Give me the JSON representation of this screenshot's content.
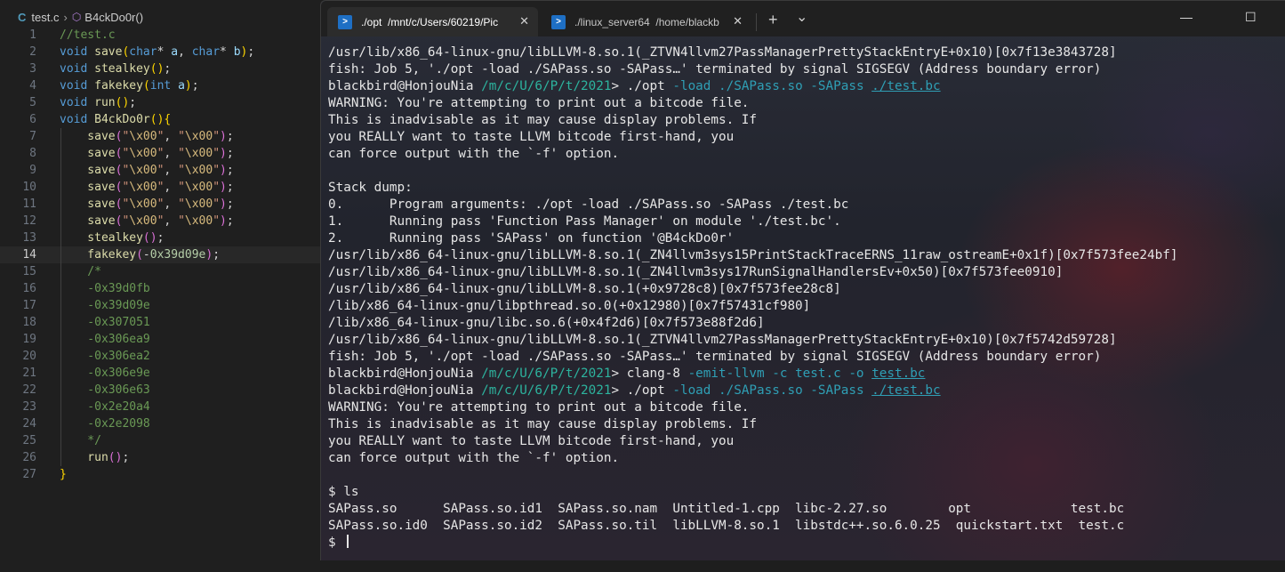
{
  "editor": {
    "breadcrumb": {
      "file_icon": "C",
      "file": "test.c",
      "symbol": "B4ckDo0r()"
    },
    "active_line": 14,
    "lines": [
      {
        "n": "1",
        "tokens": [
          {
            "t": "//test.c",
            "c": "comment"
          }
        ]
      },
      {
        "n": "2",
        "tokens": [
          {
            "t": "void ",
            "c": "kw"
          },
          {
            "t": "save",
            "c": "fn"
          },
          {
            "t": "(",
            "c": "br1"
          },
          {
            "t": "char",
            "c": "kw"
          },
          {
            "t": "* ",
            "c": "plain"
          },
          {
            "t": "a",
            "c": "param"
          },
          {
            "t": ", ",
            "c": "plain"
          },
          {
            "t": "char",
            "c": "kw"
          },
          {
            "t": "* ",
            "c": "plain"
          },
          {
            "t": "b",
            "c": "param"
          },
          {
            "t": ")",
            "c": "br1"
          },
          {
            "t": ";",
            "c": "plain"
          }
        ]
      },
      {
        "n": "3",
        "tokens": [
          {
            "t": "void ",
            "c": "kw"
          },
          {
            "t": "stealkey",
            "c": "fn"
          },
          {
            "t": "()",
            "c": "br1"
          },
          {
            "t": ";",
            "c": "plain"
          }
        ]
      },
      {
        "n": "4",
        "tokens": [
          {
            "t": "void ",
            "c": "kw"
          },
          {
            "t": "fakekey",
            "c": "fn"
          },
          {
            "t": "(",
            "c": "br1"
          },
          {
            "t": "int ",
            "c": "kw"
          },
          {
            "t": "a",
            "c": "param"
          },
          {
            "t": ")",
            "c": "br1"
          },
          {
            "t": ";",
            "c": "plain"
          }
        ]
      },
      {
        "n": "5",
        "tokens": [
          {
            "t": "void ",
            "c": "kw"
          },
          {
            "t": "run",
            "c": "fn"
          },
          {
            "t": "()",
            "c": "br1"
          },
          {
            "t": ";",
            "c": "plain"
          }
        ]
      },
      {
        "n": "6",
        "tokens": [
          {
            "t": "void ",
            "c": "kw"
          },
          {
            "t": "B4ckDo0r",
            "c": "fn"
          },
          {
            "t": "()",
            "c": "br1"
          },
          {
            "t": "{",
            "c": "br1"
          }
        ]
      },
      {
        "n": "7",
        "tokens": [
          {
            "t": "    save",
            "c": "fn"
          },
          {
            "t": "(",
            "c": "br2"
          },
          {
            "t": "\"",
            "c": "str"
          },
          {
            "t": "\\x00",
            "c": "esc"
          },
          {
            "t": "\"",
            "c": "str"
          },
          {
            "t": ", ",
            "c": "plain"
          },
          {
            "t": "\"",
            "c": "str"
          },
          {
            "t": "\\x00",
            "c": "esc"
          },
          {
            "t": "\"",
            "c": "str"
          },
          {
            "t": ")",
            "c": "br2"
          },
          {
            "t": ";",
            "c": "plain"
          }
        ]
      },
      {
        "n": "8",
        "tokens": [
          {
            "t": "    save",
            "c": "fn"
          },
          {
            "t": "(",
            "c": "br2"
          },
          {
            "t": "\"",
            "c": "str"
          },
          {
            "t": "\\x00",
            "c": "esc"
          },
          {
            "t": "\"",
            "c": "str"
          },
          {
            "t": ", ",
            "c": "plain"
          },
          {
            "t": "\"",
            "c": "str"
          },
          {
            "t": "\\x00",
            "c": "esc"
          },
          {
            "t": "\"",
            "c": "str"
          },
          {
            "t": ")",
            "c": "br2"
          },
          {
            "t": ";",
            "c": "plain"
          }
        ]
      },
      {
        "n": "9",
        "tokens": [
          {
            "t": "    save",
            "c": "fn"
          },
          {
            "t": "(",
            "c": "br2"
          },
          {
            "t": "\"",
            "c": "str"
          },
          {
            "t": "\\x00",
            "c": "esc"
          },
          {
            "t": "\"",
            "c": "str"
          },
          {
            "t": ", ",
            "c": "plain"
          },
          {
            "t": "\"",
            "c": "str"
          },
          {
            "t": "\\x00",
            "c": "esc"
          },
          {
            "t": "\"",
            "c": "str"
          },
          {
            "t": ")",
            "c": "br2"
          },
          {
            "t": ";",
            "c": "plain"
          }
        ]
      },
      {
        "n": "10",
        "tokens": [
          {
            "t": "    save",
            "c": "fn"
          },
          {
            "t": "(",
            "c": "br2"
          },
          {
            "t": "\"",
            "c": "str"
          },
          {
            "t": "\\x00",
            "c": "esc"
          },
          {
            "t": "\"",
            "c": "str"
          },
          {
            "t": ", ",
            "c": "plain"
          },
          {
            "t": "\"",
            "c": "str"
          },
          {
            "t": "\\x00",
            "c": "esc"
          },
          {
            "t": "\"",
            "c": "str"
          },
          {
            "t": ")",
            "c": "br2"
          },
          {
            "t": ";",
            "c": "plain"
          }
        ]
      },
      {
        "n": "11",
        "tokens": [
          {
            "t": "    save",
            "c": "fn"
          },
          {
            "t": "(",
            "c": "br2"
          },
          {
            "t": "\"",
            "c": "str"
          },
          {
            "t": "\\x00",
            "c": "esc"
          },
          {
            "t": "\"",
            "c": "str"
          },
          {
            "t": ", ",
            "c": "plain"
          },
          {
            "t": "\"",
            "c": "str"
          },
          {
            "t": "\\x00",
            "c": "esc"
          },
          {
            "t": "\"",
            "c": "str"
          },
          {
            "t": ")",
            "c": "br2"
          },
          {
            "t": ";",
            "c": "plain"
          }
        ]
      },
      {
        "n": "12",
        "tokens": [
          {
            "t": "    save",
            "c": "fn"
          },
          {
            "t": "(",
            "c": "br2"
          },
          {
            "t": "\"",
            "c": "str"
          },
          {
            "t": "\\x00",
            "c": "esc"
          },
          {
            "t": "\"",
            "c": "str"
          },
          {
            "t": ", ",
            "c": "plain"
          },
          {
            "t": "\"",
            "c": "str"
          },
          {
            "t": "\\x00",
            "c": "esc"
          },
          {
            "t": "\"",
            "c": "str"
          },
          {
            "t": ")",
            "c": "br2"
          },
          {
            "t": ";",
            "c": "plain"
          }
        ]
      },
      {
        "n": "13",
        "tokens": [
          {
            "t": "    stealkey",
            "c": "fn"
          },
          {
            "t": "()",
            "c": "br2"
          },
          {
            "t": ";",
            "c": "plain"
          }
        ]
      },
      {
        "n": "14",
        "tokens": [
          {
            "t": "    fakekey",
            "c": "fn"
          },
          {
            "t": "(",
            "c": "br2"
          },
          {
            "t": "-",
            "c": "plain"
          },
          {
            "t": "0x39d09e",
            "c": "num"
          },
          {
            "t": ")",
            "c": "br2"
          },
          {
            "t": ";",
            "c": "plain"
          }
        ]
      },
      {
        "n": "15",
        "tokens": [
          {
            "t": "    /*",
            "c": "comment"
          }
        ]
      },
      {
        "n": "16",
        "tokens": [
          {
            "t": "    -0x39d0fb",
            "c": "comment"
          }
        ]
      },
      {
        "n": "17",
        "tokens": [
          {
            "t": "    -0x39d09e",
            "c": "comment"
          }
        ]
      },
      {
        "n": "18",
        "tokens": [
          {
            "t": "    -0x307051",
            "c": "comment"
          }
        ]
      },
      {
        "n": "19",
        "tokens": [
          {
            "t": "    -0x306ea9",
            "c": "comment"
          }
        ]
      },
      {
        "n": "20",
        "tokens": [
          {
            "t": "    -0x306ea2",
            "c": "comment"
          }
        ]
      },
      {
        "n": "21",
        "tokens": [
          {
            "t": "    -0x306e9e",
            "c": "comment"
          }
        ]
      },
      {
        "n": "22",
        "tokens": [
          {
            "t": "    -0x306e63",
            "c": "comment"
          }
        ]
      },
      {
        "n": "23",
        "tokens": [
          {
            "t": "    -0x2e20a4",
            "c": "comment"
          }
        ]
      },
      {
        "n": "24",
        "tokens": [
          {
            "t": "    -0x2e2098",
            "c": "comment"
          }
        ]
      },
      {
        "n": "25",
        "tokens": [
          {
            "t": "    */",
            "c": "comment"
          }
        ]
      },
      {
        "n": "26",
        "tokens": [
          {
            "t": "    run",
            "c": "fn"
          },
          {
            "t": "()",
            "c": "br2"
          },
          {
            "t": ";",
            "c": "plain"
          }
        ]
      },
      {
        "n": "27",
        "tokens": [
          {
            "t": "}",
            "c": "br1"
          }
        ]
      }
    ]
  },
  "terminal": {
    "tabs": [
      {
        "title": "./opt  /mnt/c/Users/60219/Pic",
        "icon": "linux-shell-icon",
        "active": true
      },
      {
        "title": "./linux_server64  /home/blackb",
        "icon": "linux-shell-icon",
        "active": false
      }
    ],
    "new_tab_label": "+",
    "dropdown_label": "⌄",
    "minimize_label": "—",
    "maximize_label": "☐",
    "prompt": {
      "host": "blackbird@HonjouNia",
      "path": "/m/c/U/6/P/t/2021"
    },
    "lines": [
      {
        "segs": [
          {
            "t": "/usr/lib/x86_64-linux-gnu/libLLVM-8.so.1(_ZTVN4llvm27PassManagerPrettyStackEntryE+0x10)[0x7f13e3843728]",
            "c": "out"
          }
        ]
      },
      {
        "segs": [
          {
            "t": "fish: Job 5, './opt -load ./SAPass.so -SAPass…' terminated by signal SIGSEGV (Address boundary error)",
            "c": "out"
          }
        ]
      },
      {
        "segs": [
          {
            "t": "blackbird@HonjouNia ",
            "c": "host"
          },
          {
            "t": "/m/c/U/6/P/t/2021",
            "c": "path"
          },
          {
            "t": "> ./opt ",
            "c": "cmd"
          },
          {
            "t": "-load ./SAPass.so -SAPass ",
            "c": "opt"
          },
          {
            "t": "./test.bc",
            "c": "file"
          }
        ]
      },
      {
        "segs": [
          {
            "t": "WARNING: You're attempting to print out a bitcode file.",
            "c": "out"
          }
        ]
      },
      {
        "segs": [
          {
            "t": "This is inadvisable as it may cause display problems. If",
            "c": "out"
          }
        ]
      },
      {
        "segs": [
          {
            "t": "you REALLY want to taste LLVM bitcode first-hand, you",
            "c": "out"
          }
        ]
      },
      {
        "segs": [
          {
            "t": "can force output with the `-f' option.",
            "c": "out"
          }
        ]
      },
      {
        "segs": [
          {
            "t": "",
            "c": "out"
          }
        ]
      },
      {
        "segs": [
          {
            "t": "Stack dump:",
            "c": "out"
          }
        ]
      },
      {
        "segs": [
          {
            "t": "0.      Program arguments: ./opt -load ./SAPass.so -SAPass ./test.bc",
            "c": "out"
          }
        ]
      },
      {
        "segs": [
          {
            "t": "1.      Running pass 'Function Pass Manager' on module './test.bc'.",
            "c": "out"
          }
        ]
      },
      {
        "segs": [
          {
            "t": "2.      Running pass 'SAPass' on function '@B4ckDo0r'",
            "c": "out"
          }
        ]
      },
      {
        "segs": [
          {
            "t": "/usr/lib/x86_64-linux-gnu/libLLVM-8.so.1(_ZN4llvm3sys15PrintStackTraceERNS_11raw_ostreamE+0x1f)[0x7f573fee24bf]",
            "c": "out"
          }
        ]
      },
      {
        "segs": [
          {
            "t": "/usr/lib/x86_64-linux-gnu/libLLVM-8.so.1(_ZN4llvm3sys17RunSignalHandlersEv+0x50)[0x7f573fee0910]",
            "c": "out"
          }
        ]
      },
      {
        "segs": [
          {
            "t": "/usr/lib/x86_64-linux-gnu/libLLVM-8.so.1(+0x9728c8)[0x7f573fee28c8]",
            "c": "out"
          }
        ]
      },
      {
        "segs": [
          {
            "t": "/lib/x86_64-linux-gnu/libpthread.so.0(+0x12980)[0x7f57431cf980]",
            "c": "out"
          }
        ]
      },
      {
        "segs": [
          {
            "t": "/lib/x86_64-linux-gnu/libc.so.6(+0x4f2d6)[0x7f573e88f2d6]",
            "c": "out"
          }
        ]
      },
      {
        "segs": [
          {
            "t": "/usr/lib/x86_64-linux-gnu/libLLVM-8.so.1(_ZTVN4llvm27PassManagerPrettyStackEntryE+0x10)[0x7f5742d59728]",
            "c": "out"
          }
        ]
      },
      {
        "segs": [
          {
            "t": "fish: Job 5, './opt -load ./SAPass.so -SAPass…' terminated by signal SIGSEGV (Address boundary error)",
            "c": "out"
          }
        ]
      },
      {
        "segs": [
          {
            "t": "blackbird@HonjouNia ",
            "c": "host"
          },
          {
            "t": "/m/c/U/6/P/t/2021",
            "c": "path"
          },
          {
            "t": "> clang-8 ",
            "c": "cmd"
          },
          {
            "t": "-emit-llvm -c test.c -o ",
            "c": "opt"
          },
          {
            "t": "test.bc",
            "c": "file"
          }
        ]
      },
      {
        "segs": [
          {
            "t": "blackbird@HonjouNia ",
            "c": "host"
          },
          {
            "t": "/m/c/U/6/P/t/2021",
            "c": "path"
          },
          {
            "t": "> ./opt ",
            "c": "cmd"
          },
          {
            "t": "-load ./SAPass.so -SAPass ",
            "c": "opt"
          },
          {
            "t": "./test.bc",
            "c": "file"
          }
        ]
      },
      {
        "segs": [
          {
            "t": "WARNING: You're attempting to print out a bitcode file.",
            "c": "out"
          }
        ]
      },
      {
        "segs": [
          {
            "t": "This is inadvisable as it may cause display problems. If",
            "c": "out"
          }
        ]
      },
      {
        "segs": [
          {
            "t": "you REALLY want to taste LLVM bitcode first-hand, you",
            "c": "out"
          }
        ]
      },
      {
        "segs": [
          {
            "t": "can force output with the `-f' option.",
            "c": "out"
          }
        ]
      },
      {
        "segs": [
          {
            "t": "",
            "c": "out"
          }
        ]
      },
      {
        "segs": [
          {
            "t": "$ ls",
            "c": "out"
          }
        ]
      },
      {
        "segs": [
          {
            "t": "SAPass.so      SAPass.so.id1  SAPass.so.nam  Untitled-1.cpp  libc-2.27.so        opt             test.bc",
            "c": "out"
          }
        ]
      },
      {
        "segs": [
          {
            "t": "SAPass.so.id0  SAPass.so.id2  SAPass.so.til  libLLVM-8.so.1  libstdc++.so.6.0.25  quickstart.txt  test.c",
            "c": "out"
          }
        ]
      },
      {
        "segs": [
          {
            "t": "$ ",
            "c": "out"
          }
        ],
        "cursor": true
      }
    ]
  }
}
